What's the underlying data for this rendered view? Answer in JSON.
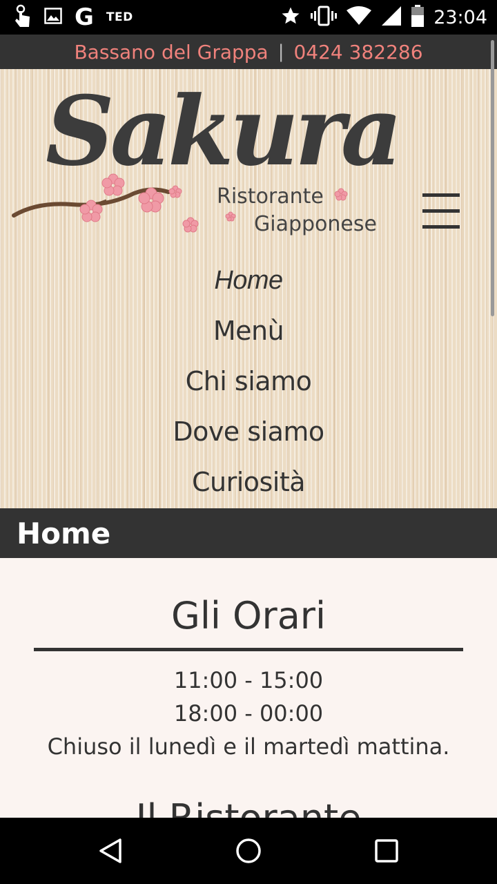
{
  "status_bar": {
    "time": "23:04",
    "notification_text": "TED",
    "google_letter": "G",
    "icons": [
      "touch-icon",
      "image-icon",
      "google-icon",
      "star-icon",
      "vibrate-icon",
      "wifi-icon",
      "signal-icon",
      "battery-icon"
    ]
  },
  "site": {
    "city": "Bassano del Grappa",
    "separator": "|",
    "phone": "0424 382286",
    "brand_name": "Sakura",
    "subtitle_line1": "Ristorante",
    "subtitle_line2": "Giapponese"
  },
  "nav": {
    "items": [
      {
        "label": "Home"
      },
      {
        "label": "Menù"
      },
      {
        "label": "Chi siamo"
      },
      {
        "label": "Dove siamo"
      },
      {
        "label": "Curiosità"
      }
    ],
    "active_index": 0
  },
  "page_title": "Home",
  "hours": {
    "title": "Gli Orari",
    "lines": [
      "11:00 - 15:00",
      "18:00 - 00:00",
      "Chiuso il lunedì e il martedì mattina."
    ]
  },
  "next_section_title": "Il Ristorante",
  "colors": {
    "accent_pink": "#f0827c",
    "dark": "#333333",
    "content_bg": "#fbf4f1",
    "header_bg": "#ecdcc4"
  }
}
